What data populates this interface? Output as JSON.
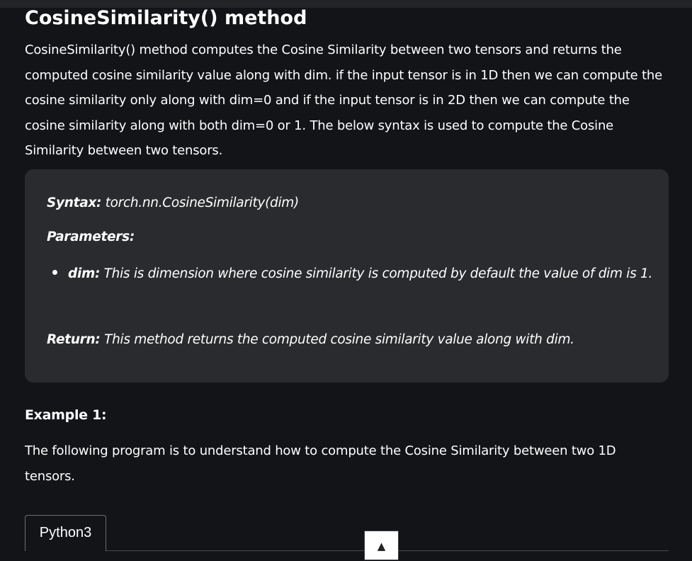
{
  "article": {
    "title": "CosineSimilarity() method",
    "intro": "CosineSimilarity() method computes the Cosine Similarity between two tensors and returns the computed cosine similarity value along with dim. if the input tensor is in 1D then we can compute the cosine similarity only along with dim=0 and if the input tensor is in 2D then we can compute the cosine similarity along with both dim=0 or 1. The below syntax is used to compute the Cosine Similarity between two tensors."
  },
  "syntax_box": {
    "syntax_label": "Syntax:",
    "syntax_value": " torch.nn.CosineSimilarity(dim)",
    "parameters_label": "Parameters:",
    "parameters": [
      {
        "name": "dim:",
        "description": " This is dimension where cosine similarity is computed by default the value of dim is 1."
      }
    ],
    "return_label": "Return:",
    "return_value": " This method returns the computed cosine similarity value along with dim."
  },
  "example": {
    "heading": "Example 1:",
    "text": "The following program is to understand how to compute the Cosine Similarity between two 1D tensors."
  },
  "code_tabs": {
    "active_tab": "Python3"
  },
  "scroll_top": {
    "glyph": "▲"
  }
}
